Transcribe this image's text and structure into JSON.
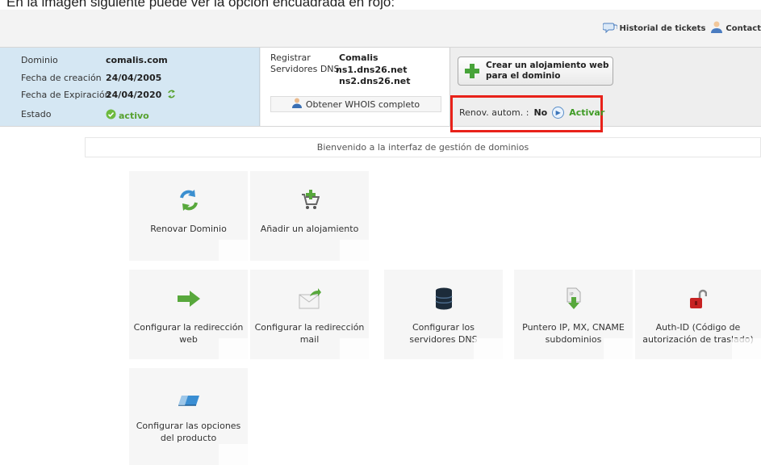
{
  "caption": "En la imagen siguiente puede ver la opción encuadrada en rojo:",
  "top_links": {
    "tickets": "Historial de tickets",
    "contact": "Contact"
  },
  "domain_info": {
    "domain_label": "Dominio",
    "domain_value": "comalis.com",
    "created_label": "Fecha de creación",
    "created_value": "24/04/2005",
    "expiry_label": "Fecha de Expiración",
    "expiry_value": "24/04/2020",
    "status_label": "Estado",
    "status_value": "activo"
  },
  "registrar": {
    "registrar_label": "Registrar",
    "registrar_value": "Comalis",
    "dns_label": "Servidores DNS",
    "dns1": "ns1.dns26.net",
    "dns2": "ns2.dns26.net",
    "whois_button": "Obtener WHOIS completo"
  },
  "hosting_button": {
    "line1": "Crear un alojamiento web",
    "line2": "para el dominio"
  },
  "auto_renew": {
    "label": "Renov. autom. :",
    "value": "No",
    "action": "Activar"
  },
  "welcome": "Bienvenido a la interfaz de gestión de dominios",
  "tiles": {
    "renew": {
      "line1": "Renovar Dominio",
      "line2": ""
    },
    "add_hosting": {
      "line1": "Añadir un alojamiento",
      "line2": ""
    },
    "web_redirect": {
      "line1": "Configurar la redirección",
      "line2": "web"
    },
    "mail_redirect": {
      "line1": "Configurar la redirección",
      "line2": "mail"
    },
    "dns_servers": {
      "line1": "Configurar los",
      "line2": "servidores DNS"
    },
    "ip_pointer": {
      "line1": "Puntero IP, MX, CNAME",
      "line2": "subdominios"
    },
    "auth_id": {
      "line1": "Auth-ID (Código de",
      "line2": "autorización de traslado)"
    },
    "product_options": {
      "line1": "Configurar las opciones",
      "line2": "del producto"
    }
  },
  "colors": {
    "highlight_red": "#e8221a",
    "active_green": "#3f9b25",
    "domain_panel_blue": "#d5e7f3"
  }
}
